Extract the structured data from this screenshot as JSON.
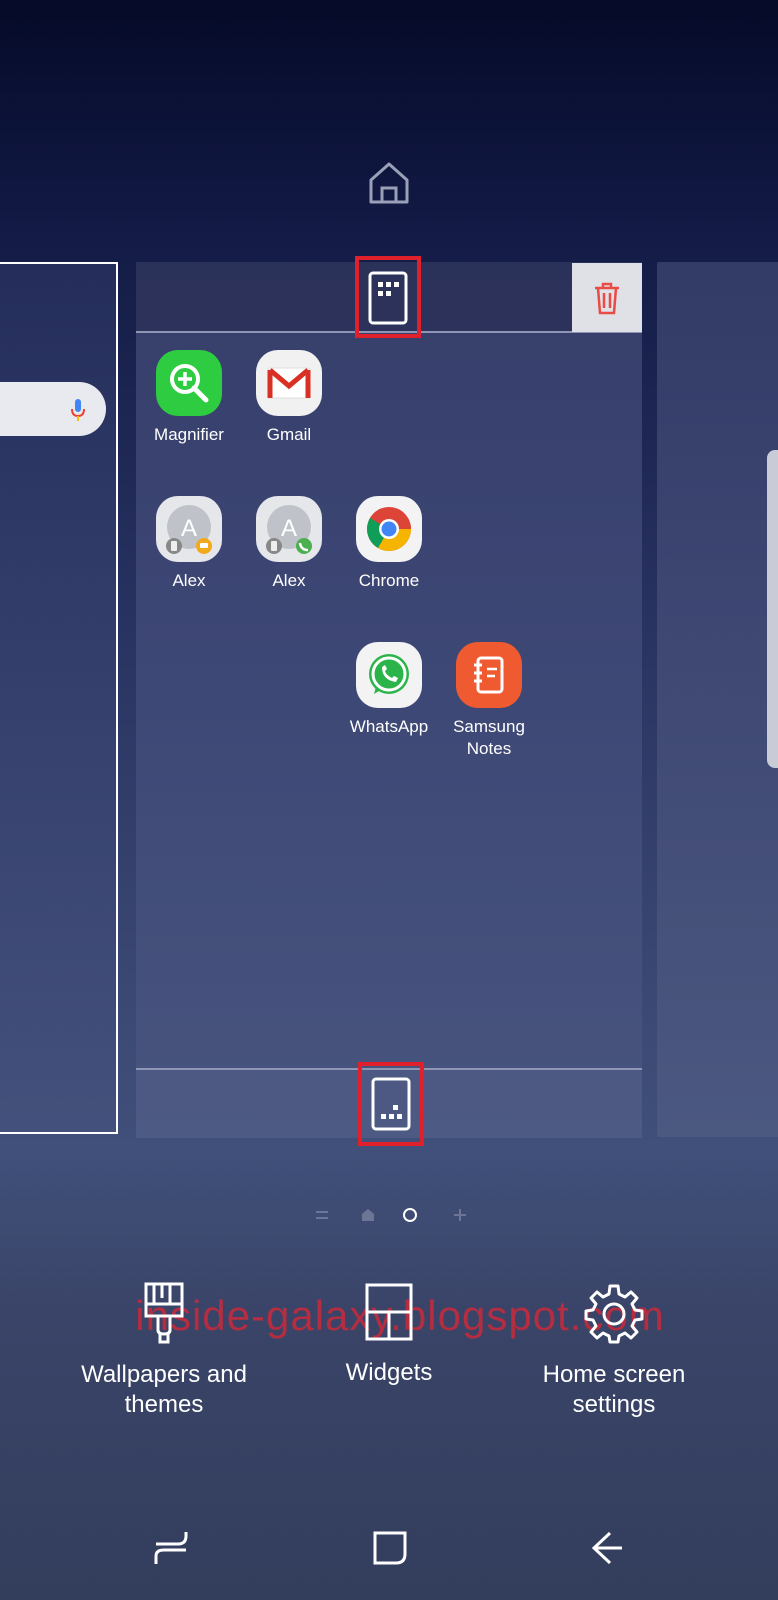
{
  "editor": {
    "top_home_icon": "home-outline-icon",
    "center_page": {
      "apps": [
        {
          "label": "Magnifier",
          "icon": "magnifier-icon",
          "color": "#2ecc40"
        },
        {
          "label": "Gmail",
          "icon": "gmail-icon",
          "color": "#ffffff"
        },
        {
          "label": "Alex",
          "icon": "contact-message-icon",
          "color": "#e6e7ea"
        },
        {
          "label": "Alex",
          "icon": "contact-call-icon",
          "color": "#e6e7ea"
        },
        {
          "label": "Chrome",
          "icon": "chrome-icon",
          "color": "#ffffff"
        },
        {
          "label": "WhatsApp",
          "icon": "whatsapp-icon",
          "color": "#2bb44a"
        },
        {
          "label": "Samsung Notes",
          "icon": "samsung-notes-icon",
          "color": "#f05a30"
        }
      ],
      "highlight_color": "#e0202a"
    },
    "page_indicator": {
      "current_index": 2
    }
  },
  "options": {
    "wallpapers": "Wallpapers and themes",
    "widgets": "Widgets",
    "home_settings": "Home screen settings"
  },
  "watermark": "inside-galaxy.blogspot.com"
}
